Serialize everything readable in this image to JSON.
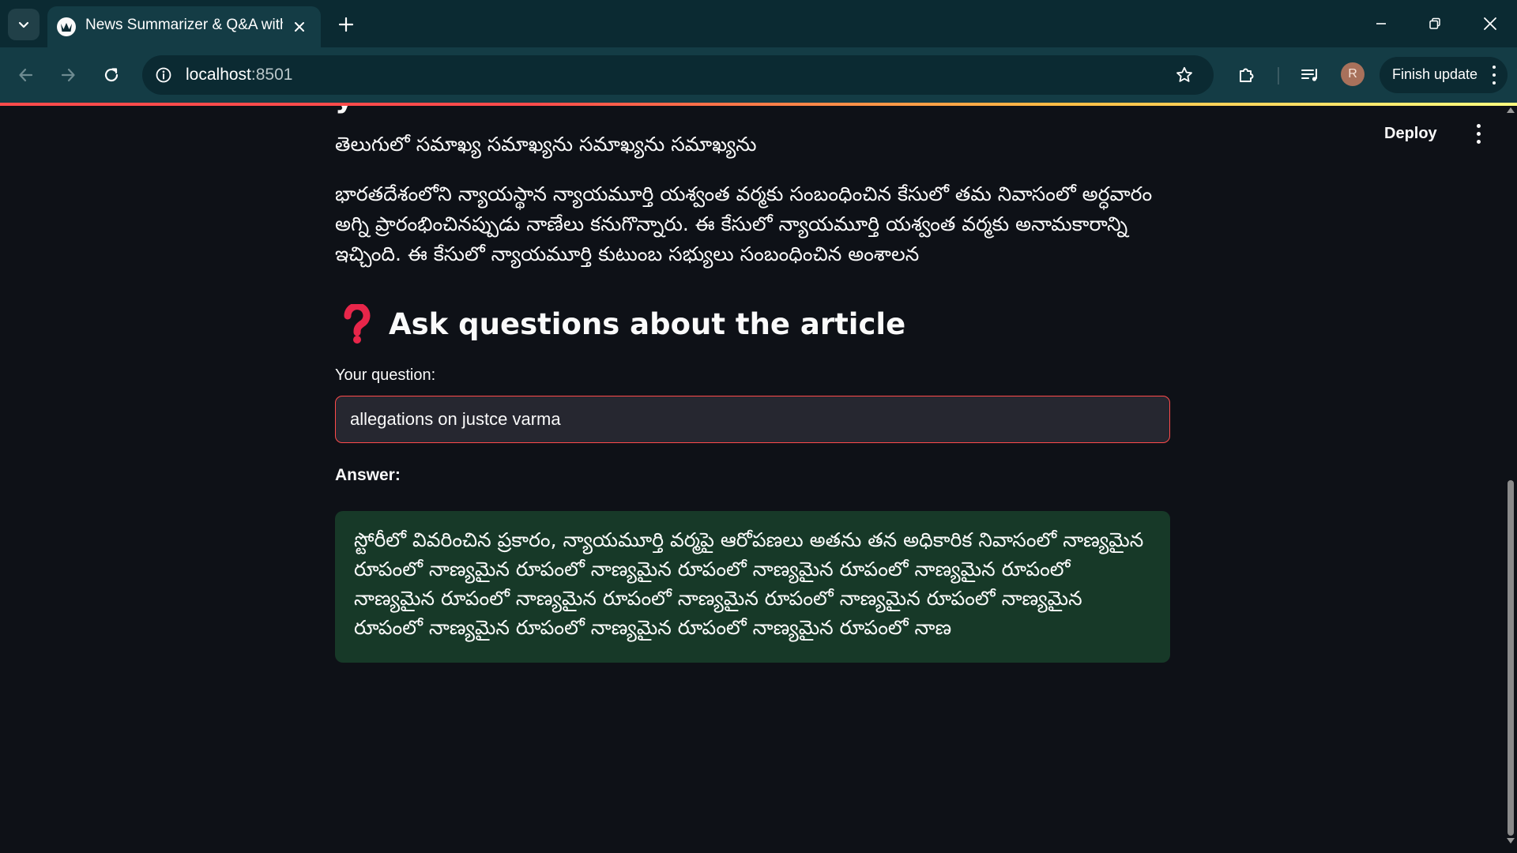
{
  "browser": {
    "tab": {
      "title": "News Summarizer & Q&A with"
    },
    "address": {
      "host": "localhost",
      "port": ":8501"
    },
    "finish_update_label": "Finish update",
    "profile_initial": "R"
  },
  "app": {
    "deploy_label": "Deploy",
    "subtitle": "తెలుగులో సమాఖ్య సమాఖ్యను సమాఖ్యను సమాఖ్యను",
    "summary": "భారతదేశంలోని న్యాయస్థాన న్యాయమూర్తి యశ్వంత వర్మకు సంబంధించిన కేసులో తమ నివాసంలో అర్ధవారం అగ్ని ప్రారంభించినప్పుడు నాణేలు కనుగొన్నారు. ఈ కేసులో న్యాయమూర్తి యశ్వంత వర్మకు అనామకారాన్ని ఇచ్చింది. ఈ కేసులో న్యాయమూర్తి కుటుంబ సభ్యులు సంబంధించిన అంశాలన",
    "qa_heading": "Ask questions about the article",
    "question_label": "Your question:",
    "question_value": "allegations on justce varma",
    "answer_label": "Answer:",
    "answer_text": "స్టోరీలో వివరించిన ప్రకారం, న్యాయమూర్తి వర్మపై ఆరోపణలు అతను తన అధికారిక నివాసంలో నాణ్యమైన రూపంలో నాణ్యమైన రూపంలో నాణ్యమైన రూపంలో నాణ్యమైన రూపంలో నాణ్యమైన రూపంలో నాణ్యమైన రూపంలో నాణ్యమైన రూపంలో నాణ్యమైన రూపంలో నాణ్యమైన రూపంలో నాణ్యమైన రూపంలో నాణ్యమైన రూపంలో నాణ్యమైన రూపంలో నాణ్యమైన రూపంలో నాణ"
  },
  "icons": {
    "tab_menu": "chevron-down-icon",
    "favicon": "streamlit-crown-icon",
    "tab_close": "close-icon",
    "new_tab": "plus-icon",
    "back": "arrow-left-icon",
    "forward": "arrow-right-icon",
    "reload": "reload-icon",
    "site_info": "info-icon",
    "bookmark": "star-icon",
    "extensions": "puzzle-icon",
    "media": "media-controls-icon",
    "question_mark": "red-question-mark-icon"
  },
  "colors": {
    "chrome_dark": "#0b2a32",
    "chrome_toolbar": "#143c45",
    "page_bg": "#0e1117",
    "input_bg": "#262730",
    "input_focus_border": "#ff4b4b",
    "answer_bg": "#173928",
    "accent_red": "#ff4b4b"
  }
}
